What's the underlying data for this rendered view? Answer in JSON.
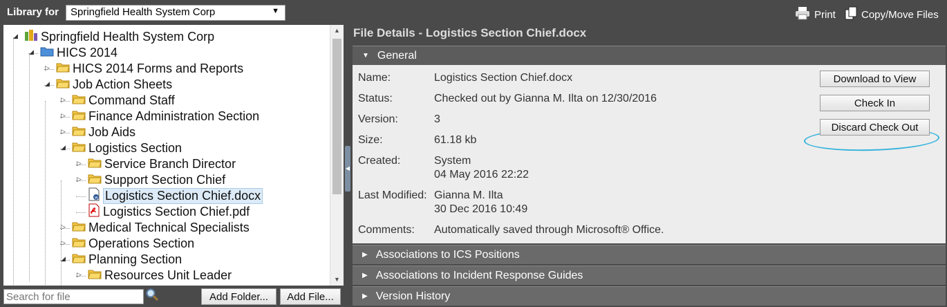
{
  "topbar": {
    "library_label": "Library for",
    "library_selected": "Springfield Health System Corp",
    "print_label": "Print",
    "copy_label": "Copy/Move Files"
  },
  "tree": {
    "items": [
      {
        "label": "Springfield Health System Corp",
        "type": "org"
      },
      {
        "label": "HICS 2014",
        "type": "folder-blue"
      },
      {
        "label": "HICS 2014 Forms and Reports",
        "type": "folder"
      },
      {
        "label": "Job Action Sheets",
        "type": "folder"
      },
      {
        "label": "Command Staff",
        "type": "folder"
      },
      {
        "label": "Finance Administration Section",
        "type": "folder"
      },
      {
        "label": "Job Aids",
        "type": "folder"
      },
      {
        "label": "Logistics Section",
        "type": "folder"
      },
      {
        "label": "Service Branch Director",
        "type": "folder"
      },
      {
        "label": "Support Section Chief",
        "type": "folder"
      },
      {
        "label": "Logistics Section Chief.docx",
        "type": "docx",
        "selected": true
      },
      {
        "label": "Logistics Section Chief.pdf",
        "type": "pdf"
      },
      {
        "label": "Medical Technical Specialists",
        "type": "folder"
      },
      {
        "label": "Operations Section",
        "type": "folder"
      },
      {
        "label": "Planning Section",
        "type": "folder"
      },
      {
        "label": "Resources Unit Leader",
        "type": "folder"
      }
    ]
  },
  "left_bottom": {
    "search_placeholder": "Search for file",
    "add_folder_label": "Add Folder...",
    "add_file_label": "Add File..."
  },
  "details": {
    "title": "File Details - Logistics Section Chief.docx",
    "general_header": "General",
    "fields": {
      "name_label": "Name:",
      "name_value": "Logistics Section Chief.docx",
      "status_label": "Status:",
      "status_value": "Checked out by Gianna M. Ilta on 12/30/2016",
      "version_label": "Version:",
      "version_value": "3",
      "size_label": "Size:",
      "size_value": "61.18 kb",
      "created_label": "Created:",
      "created_by": "System",
      "created_date": "04 May 2016 22:22",
      "modified_label": "Last Modified:",
      "modified_by": "Gianna M. Ilta",
      "modified_date": "30 Dec 2016 10:49",
      "comments_label": "Comments:",
      "comments_value": "Automatically saved through Microsoft® Office."
    },
    "buttons": {
      "download": "Download to View",
      "checkin": "Check In",
      "discard": "Discard Check Out"
    },
    "sections": [
      "Associations to ICS Positions",
      "Associations to Incident Response Guides",
      "Version History"
    ]
  },
  "colors": {
    "chrome": "#4a4a4a",
    "header": "#6a6a6a",
    "highlight_ring": "#34b3dc",
    "folder": "#f4c542"
  }
}
